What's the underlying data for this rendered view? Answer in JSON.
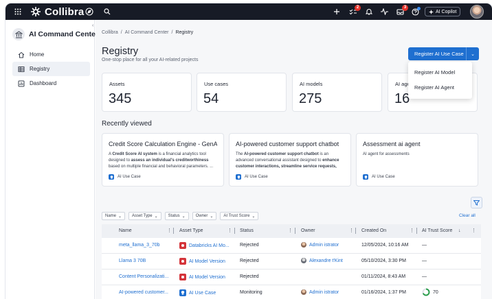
{
  "topbar": {
    "brand": "Collibra",
    "notifications_badge": "2",
    "tasks_badge": "3",
    "copilot_label": "AI Copilot"
  },
  "sidebar": {
    "title": "AI Command Center",
    "collapse_glyph": "‹",
    "items": [
      {
        "label": "Home",
        "icon": "home-icon"
      },
      {
        "label": "Registry",
        "icon": "table-icon"
      },
      {
        "label": "Dashboard",
        "icon": "chart-icon"
      }
    ]
  },
  "breadcrumb": {
    "parts": [
      "Collibra",
      "/",
      "AI Command Center",
      "/",
      "Registry"
    ]
  },
  "page": {
    "title": "Registry",
    "subtitle": "One-stop place for all your AI-related projects"
  },
  "register_button": {
    "label": "Register AI Use Case",
    "caret": "⌄"
  },
  "register_menu": [
    "Register AI Model",
    "Register AI Agent"
  ],
  "stats": [
    {
      "title": "Assets",
      "value": "345"
    },
    {
      "title": "Use cases",
      "value": "54"
    },
    {
      "title": "AI models",
      "value": "275"
    },
    {
      "title": "AI agent",
      "value": "16"
    }
  ],
  "recent": {
    "heading": "Recently viewed",
    "cards": [
      {
        "title": "Credit Score Calculation Engine - GenAI",
        "desc_html": "A <b>Credit Score AI system</b> is a financial analytics tool designed to <b>assess an individual's creditworthiness</b> based on multiple financial and behavioral parameters. ...",
        "tag": "AI Use Case"
      },
      {
        "title": "AI-powered customer support chatbot",
        "desc_html": "The <b>AI-powered customer support chatbot</b> is an advanced conversational assistant designed to <b>enhance customer interactions, streamline service requests, and...</b>",
        "tag": "AI Use Case"
      },
      {
        "title": "Assessment ai agent",
        "desc_html": "AI agent for assessments",
        "tag": "AI Use Case"
      }
    ]
  },
  "filters": [
    "Name",
    "Asset Type",
    "Status",
    "Owner",
    "AI Trust Score"
  ],
  "clear_all": "Clear all",
  "table": {
    "columns": [
      "Name",
      "Asset Type",
      "Status",
      "Owner",
      "Created On",
      "AI Trust Score"
    ],
    "sort_glyph": "↓",
    "rows": [
      {
        "name": "meta_llama_3_70b",
        "asset_type": "Databricks AI Mo...",
        "type_color": "red",
        "status": "Rejected",
        "owner": "Admin istrator",
        "created": "12/05/2024, 10:16 AM",
        "trust": "—"
      },
      {
        "name": "Llama 3 70B",
        "asset_type": "AI Model Version",
        "type_color": "red",
        "status": "Rejected",
        "owner": "Alexandre t'Kint",
        "created": "05/10/2024, 3:30 PM",
        "trust": "—"
      },
      {
        "name": "Content Personalizati...",
        "asset_type": "AI Model Version",
        "type_color": "red",
        "status": "Rejected",
        "owner": "",
        "created": "01/11/2024, 8:43 AM",
        "trust": "—"
      },
      {
        "name": "AI-powered customer...",
        "asset_type": "AI Use Case",
        "type_color": "blue",
        "status": "Monitoring",
        "owner": "Admin istrator",
        "created": "01/16/2024, 1:37 PM",
        "trust": "70"
      }
    ]
  },
  "colors": {
    "topbar": "#171b26",
    "primary": "#1f6fd0",
    "danger": "#d4343a",
    "trust_ring": "#2a9d4b"
  }
}
